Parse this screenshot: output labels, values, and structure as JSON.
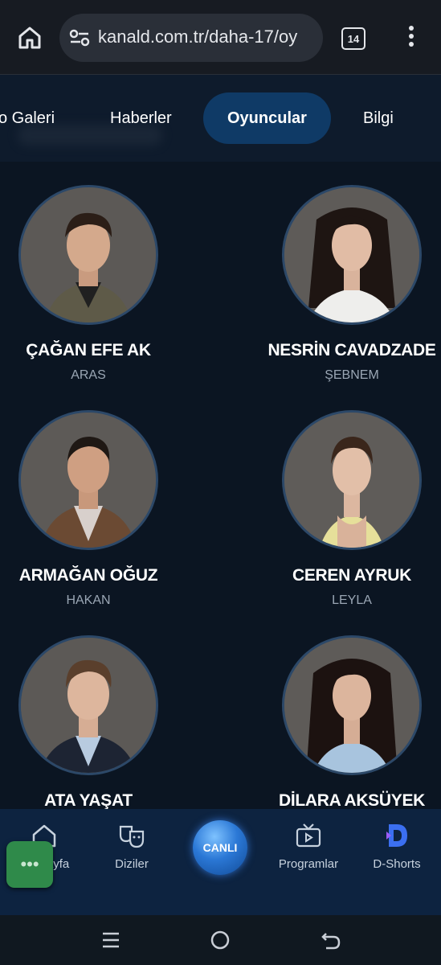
{
  "browser": {
    "url": "kanald.com.tr/daha-17/oy",
    "tab_count": "14"
  },
  "topnav": {
    "items": [
      {
        "label": "o Galeri"
      },
      {
        "label": "Haberler"
      },
      {
        "label": "Oyuncular",
        "active": true
      },
      {
        "label": "Bilgi"
      }
    ]
  },
  "cast": [
    {
      "name": "ÇAĞAN EFE AK",
      "role": "ARAS"
    },
    {
      "name": "NESRİN CAVADZADE",
      "role": "ŞEBNEM"
    },
    {
      "name": "ARMAĞAN OĞUZ",
      "role": "HAKAN"
    },
    {
      "name": "CEREN AYRUK",
      "role": "LEYLA"
    },
    {
      "name": "ATA YAŞAT",
      "role": ""
    },
    {
      "name": "DİLARA AKSÜYEK",
      "role": ""
    }
  ],
  "bottomnav": {
    "items": [
      {
        "label": "Anasayfa",
        "icon": "home-icon"
      },
      {
        "label": "Diziler",
        "icon": "masks-icon"
      },
      {
        "label": "Programlar",
        "icon": "tv-icon"
      },
      {
        "label": "D-Shorts",
        "icon": "dshorts-icon"
      }
    ],
    "live_label": "CANLI"
  },
  "colors": {
    "background": "#0b1522",
    "active_tab": "#0f3a66",
    "bottom_bar": "#0d2340",
    "role_text": "#9aa6b4"
  }
}
